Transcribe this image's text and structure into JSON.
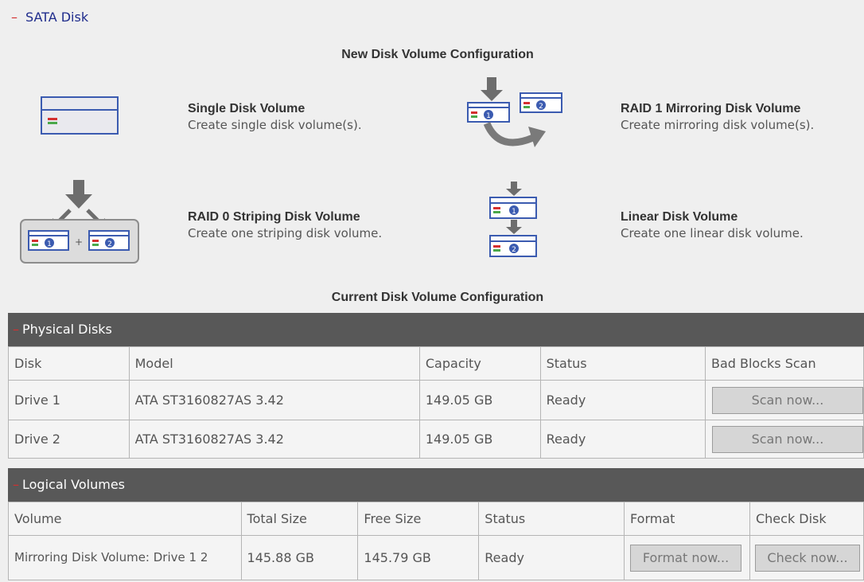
{
  "section": {
    "collapse_glyph": "–",
    "title": "SATA Disk"
  },
  "new_config": {
    "title": "New Disk Volume Configuration",
    "options": [
      {
        "title": "Single Disk Volume",
        "desc": "Create single disk volume(s)."
      },
      {
        "title": "RAID 1 Mirroring Disk Volume",
        "desc": "Create mirroring disk volume(s)."
      },
      {
        "title": "RAID 0 Striping Disk Volume",
        "desc": "Create one striping disk volume."
      },
      {
        "title": "Linear Disk Volume",
        "desc": "Create one linear disk volume."
      }
    ]
  },
  "current_config": {
    "title": "Current Disk Volume Configuration"
  },
  "physical": {
    "bar_label": "Physical Disks",
    "headers": [
      "Disk",
      "Model",
      "Capacity",
      "Status",
      "Bad Blocks Scan"
    ],
    "rows": [
      {
        "disk": "Drive 1",
        "model": "ATA ST3160827AS 3.42",
        "capacity": "149.05 GB",
        "status": "Ready",
        "action": "Scan now..."
      },
      {
        "disk": "Drive 2",
        "model": "ATA ST3160827AS 3.42",
        "capacity": "149.05 GB",
        "status": "Ready",
        "action": "Scan now..."
      }
    ]
  },
  "logical": {
    "bar_label": "Logical Volumes",
    "headers": [
      "Volume",
      "Total Size",
      "Free Size",
      "Status",
      "Format",
      "Check Disk"
    ],
    "rows": [
      {
        "volume": "Mirroring Disk Volume: Drive 1 2",
        "total": "145.88 GB",
        "free": "145.79 GB",
        "status": "Ready",
        "format": "Format now...",
        "check": "Check now..."
      }
    ]
  },
  "colors": {
    "bar_bg": "#585858",
    "accent_red": "#d43030",
    "link_blue": "#1f2c8c",
    "icon_blue": "#3b5bb0",
    "arrow_gray": "#6d6d6d"
  },
  "icons": [
    "single-disk-icon",
    "raid1-mirroring-icon",
    "raid0-striping-icon",
    "linear-disk-icon"
  ]
}
